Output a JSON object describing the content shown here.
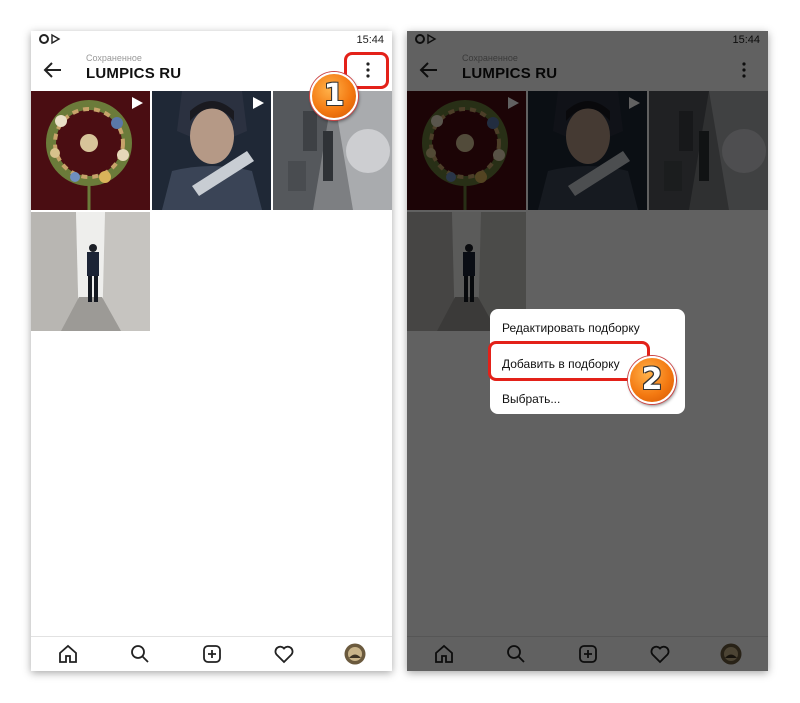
{
  "status_bar": {
    "time": "15:44"
  },
  "header": {
    "subtitle": "Сохраненное",
    "title": "LUMPICS RU"
  },
  "grid": {
    "items": [
      {
        "kind": "wreath",
        "video": true
      },
      {
        "kind": "portrait",
        "video": true
      },
      {
        "kind": "city",
        "video": false
      },
      {
        "kind": "corridor",
        "video": false
      }
    ]
  },
  "bottom_nav": [
    "home-icon",
    "search-icon",
    "add-post-icon",
    "heart-icon",
    "profile-avatar"
  ],
  "menu": {
    "items": [
      "Редактировать подборку",
      "Добавить в подборку",
      "Выбрать..."
    ]
  },
  "annotations": {
    "step1": "1",
    "step2": "2"
  },
  "colors": {
    "callout": "#e32119",
    "badge": "#f47a12",
    "dim": "rgba(0,0,0,0.62)"
  }
}
